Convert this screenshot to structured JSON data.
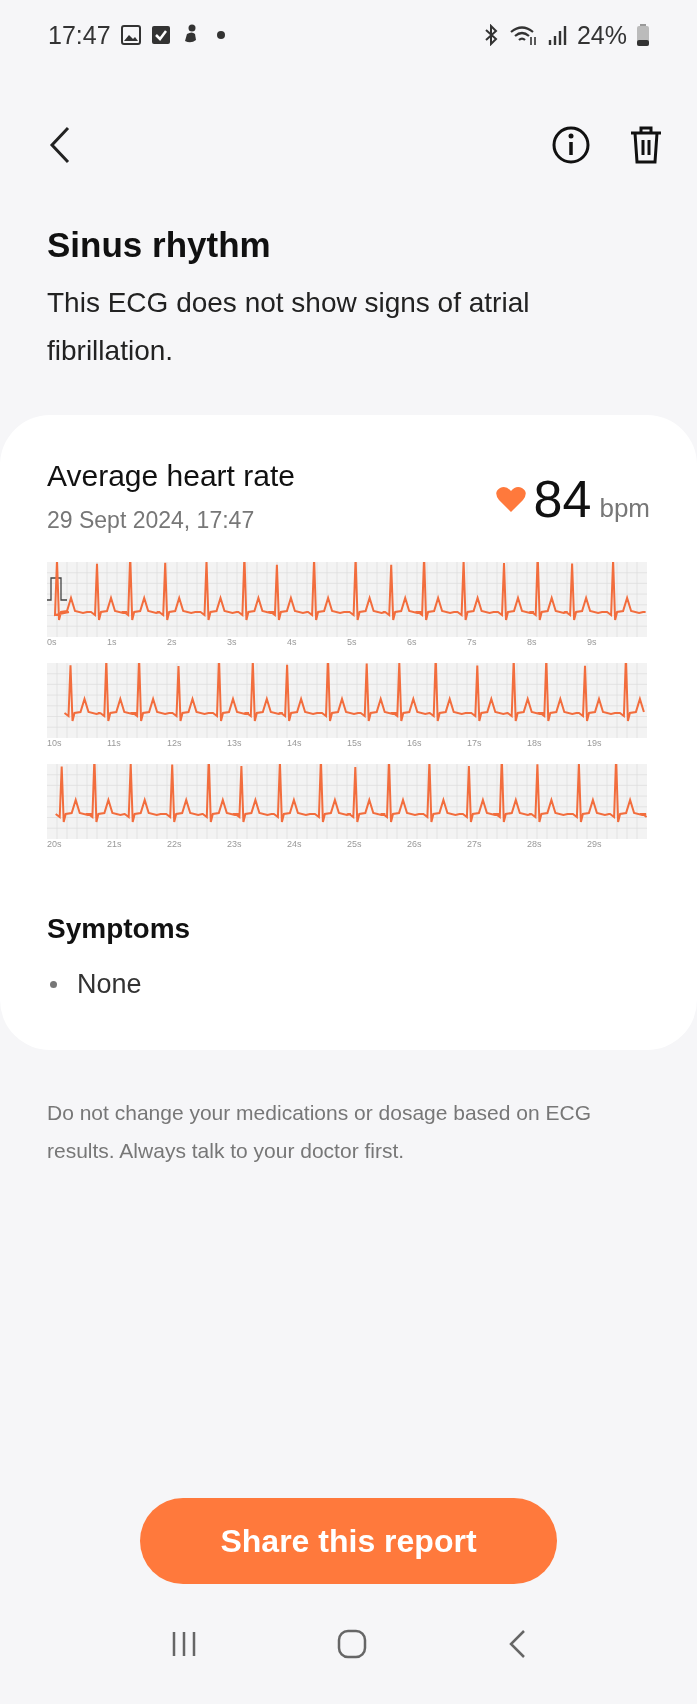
{
  "status_bar": {
    "time": "17:47",
    "battery": "24%"
  },
  "result": {
    "title": "Sinus rhythm",
    "description": "This ECG does not show signs of atrial fibrillation."
  },
  "card": {
    "label": "Average heart rate",
    "date": "29 Sept 2024, 17:47",
    "value": "84",
    "unit": "bpm",
    "strips": [
      {
        "ticks": [
          "0s",
          "1s",
          "2s",
          "3s",
          "4s",
          "5s",
          "6s",
          "7s",
          "8s",
          "9s"
        ]
      },
      {
        "ticks": [
          "10s",
          "11s",
          "12s",
          "13s",
          "14s",
          "15s",
          "16s",
          "17s",
          "18s",
          "19s"
        ]
      },
      {
        "ticks": [
          "20s",
          "21s",
          "22s",
          "23s",
          "24s",
          "25s",
          "26s",
          "27s",
          "28s",
          "29s"
        ]
      }
    ],
    "symptoms_title": "Symptoms",
    "symptoms": [
      "None"
    ]
  },
  "disclaimer": "Do not change your medications or dosage based on ECG results. Always talk to your doctor first.",
  "share_button": "Share this report"
}
